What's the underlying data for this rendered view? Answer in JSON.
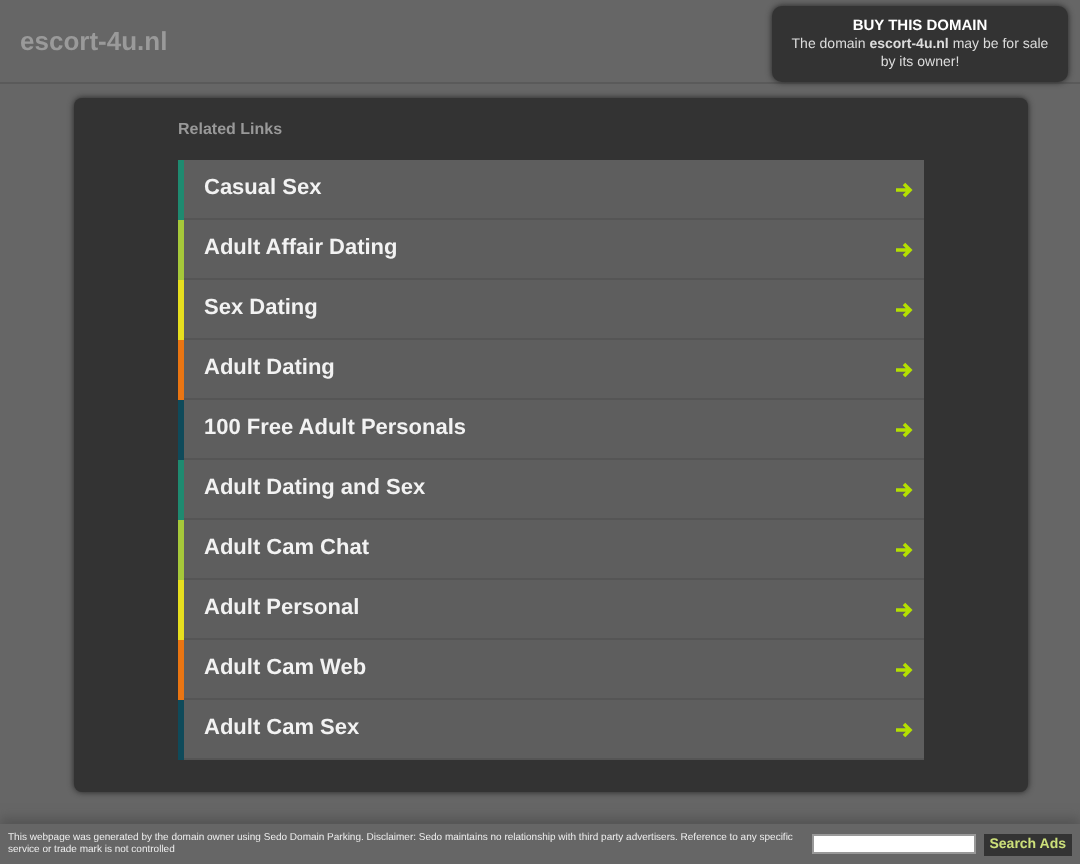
{
  "site_title": "escort-4u.nl",
  "sale_box": {
    "title": "BUY THIS DOMAIN",
    "text": "The domain **escort-4u.nl** may be for sale by its owner!"
  },
  "related_links": {
    "heading": "Related Links",
    "items": [
      {
        "label": "Casual Sex",
        "color": "#1f8a70"
      },
      {
        "label": "Adult Affair Dating",
        "color": "#a6c83a"
      },
      {
        "label": "Sex Dating",
        "color": "#e6de1e"
      },
      {
        "label": "Adult Dating",
        "color": "#ea7512"
      },
      {
        "label": "100 Free Adult Personals",
        "color": "#0f4a5a"
      },
      {
        "label": "Adult Dating and Sex",
        "color": "#1f8a70"
      },
      {
        "label": "Adult Cam Chat",
        "color": "#a6c83a"
      },
      {
        "label": "Adult Personal",
        "color": "#e6de1e"
      },
      {
        "label": "Adult Cam Web",
        "color": "#ea7512"
      },
      {
        "label": "Adult Cam Sex",
        "color": "#0f4a5a"
      }
    ]
  },
  "footer": {
    "disclaimer": "This webpage was generated by the domain owner using Sedo Domain Parking. Disclaimer: Sedo maintains no relationship with third party advertisers. Reference to any specific service or trade mark is not controlled",
    "search_button": "Search Ads"
  }
}
